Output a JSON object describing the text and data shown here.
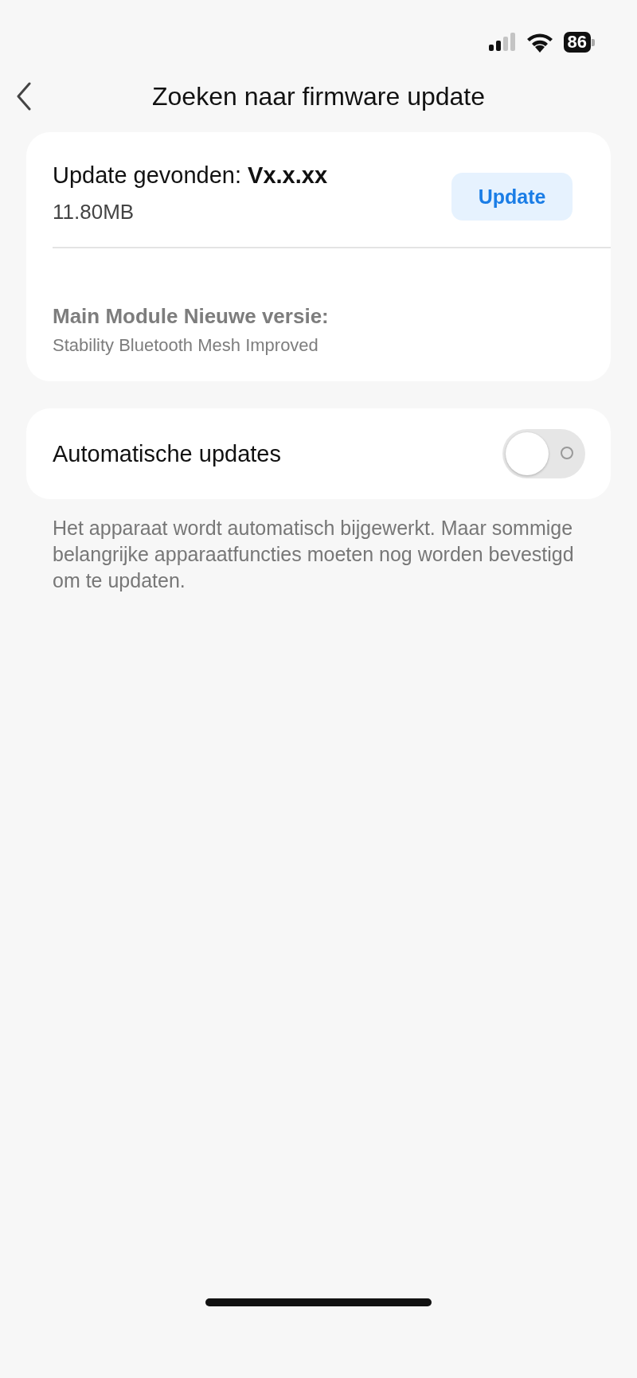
{
  "status_bar": {
    "battery": "86"
  },
  "header": {
    "title": "Zoeken naar firmware update"
  },
  "update_card": {
    "heading": "Update gevonden: **Vx.x.xx**",
    "size": "11.80MB",
    "button": "Update",
    "module_title": "Main Module Nieuwe versie:",
    "module_notes": "Stability Bluetooth Mesh Improved"
  },
  "auto_updates": {
    "label": "Automatische updates",
    "on": false
  },
  "description": "Het apparaat wordt automatisch bijgewerkt. Maar sommige belangrijke apparaatfuncties moeten nog worden bevestigd om te updaten."
}
